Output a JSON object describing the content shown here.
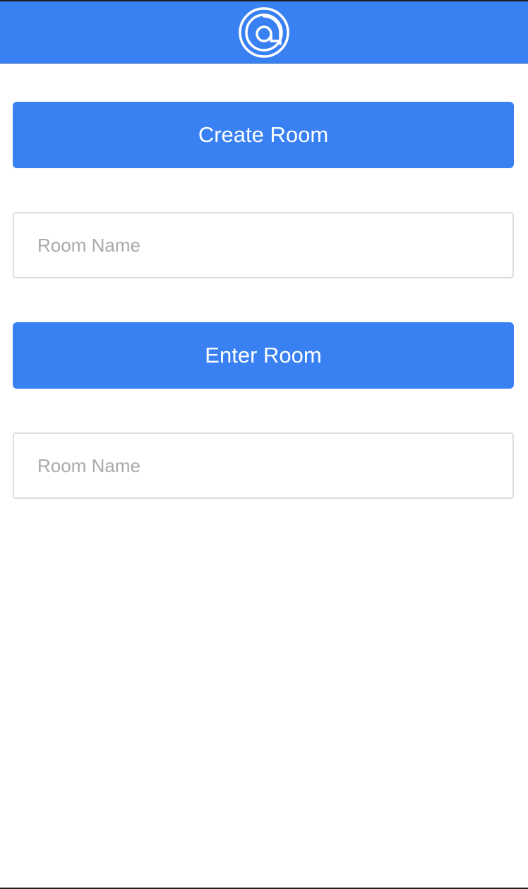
{
  "header": {
    "logo_icon": "at-sign-logo-icon",
    "background_color": "#3981f3"
  },
  "create_room": {
    "button_label": "Create Room",
    "input_value": "",
    "input_placeholder": "Room Name"
  },
  "enter_room": {
    "button_label": "Enter Room",
    "input_value": "",
    "input_placeholder": "Room Name"
  },
  "colors": {
    "accent": "#3981f3",
    "button_text": "#ffffff",
    "input_border": "#dddddd",
    "placeholder_text": "#a9a9a9"
  }
}
